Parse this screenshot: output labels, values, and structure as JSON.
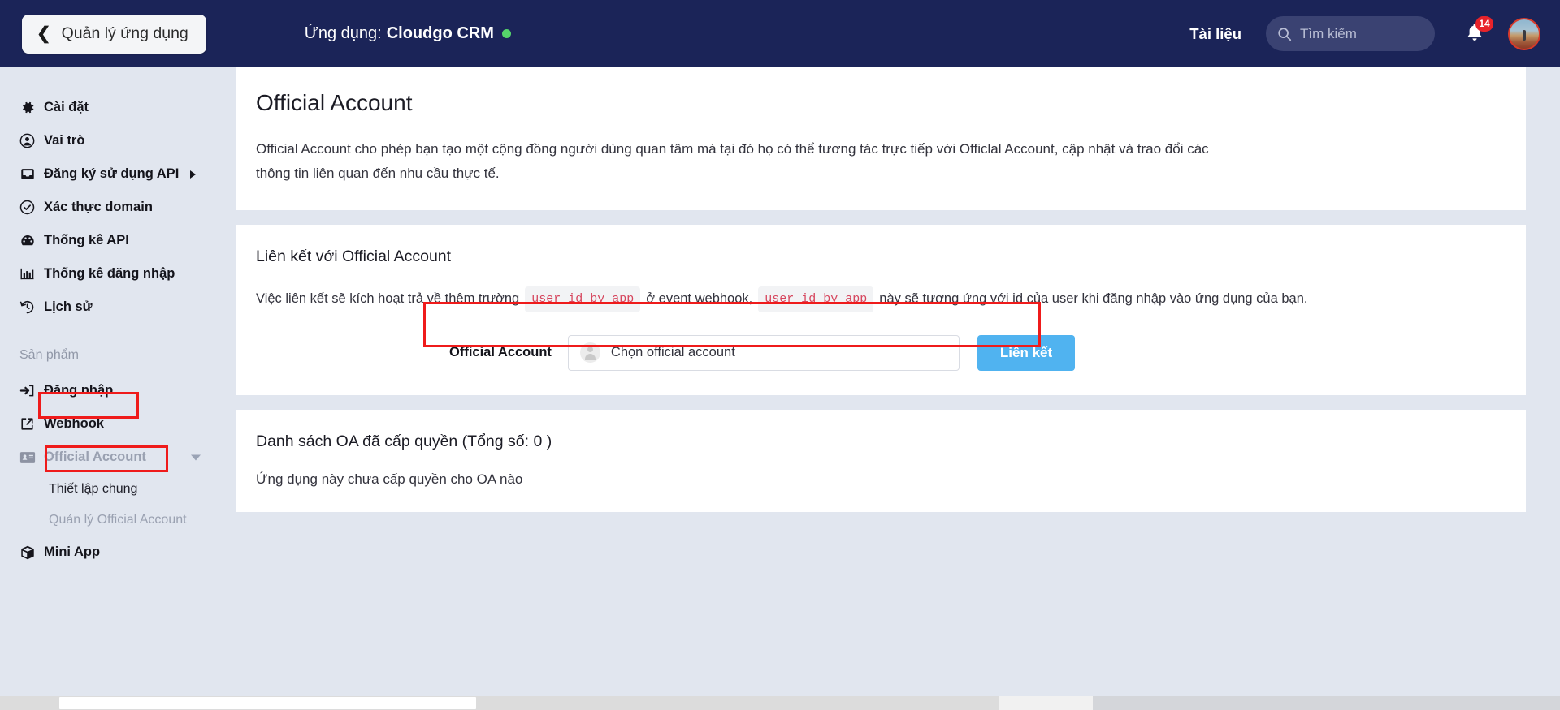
{
  "header": {
    "back_chevron": "chevron-left-icon",
    "back_label": "Quản lý ứng dụng",
    "app_prefix": "Ứng dụng:",
    "app_name": "Cloudgo CRM",
    "docs_label": "Tài liệu",
    "search_placeholder": "Tìm kiếm",
    "search_value": "",
    "notification_count": "14",
    "status_color": "#55d46a",
    "bg_color": "#1b2458"
  },
  "sidebar": {
    "items": [
      {
        "icon": "gear-icon",
        "label": "Cài đặt"
      },
      {
        "icon": "user-circle-icon",
        "label": "Vai trò"
      },
      {
        "icon": "inbox-icon",
        "label": "Đăng ký sử dụng API",
        "caret": "right"
      },
      {
        "icon": "check-circle-icon",
        "label": "Xác thực domain"
      },
      {
        "icon": "speedometer-icon",
        "label": "Thống kê API"
      },
      {
        "icon": "bar-chart-icon",
        "label": "Thống kê đăng nhập"
      },
      {
        "icon": "history-icon",
        "label": "Lịch sử"
      }
    ],
    "section_label": "Sản phẩm",
    "product_items": [
      {
        "icon": "login-icon",
        "label": "Đăng nhập"
      },
      {
        "icon": "external-link-icon",
        "label": "Webhook"
      },
      {
        "icon": "id-card-icon",
        "label": "Official Account",
        "caret": "down",
        "muted": true,
        "highlighted": true
      },
      {
        "icon": "",
        "label": "Thiết lập chung",
        "sub": true
      },
      {
        "icon": "",
        "label": "Quản lý Official Account",
        "sub": true,
        "muted": true,
        "highlighted": true
      },
      {
        "icon": "cube-icon",
        "label": "Mini App"
      }
    ]
  },
  "main": {
    "intro_card": {
      "title": "Official Account",
      "description": "Official Account cho phép bạn tạo một cộng đồng người dùng quan tâm mà tại đó họ có thể tương tác trực tiếp với Officlal Account, cập nhật và trao đổi các thông tin liên quan đến nhu cầu thực tế."
    },
    "link_card": {
      "title": "Liên kết với Official Account",
      "sentence_part1": "Việc liên kết sẽ kích hoạt trả về thêm trường",
      "code_token_1": "user_id_by_app",
      "sentence_part2": "ở event webhook,",
      "code_token_2": "user_id_by_app",
      "sentence_part3": "này sẽ tương ứng với id của user khi đăng nhập vào ứng dụng của bạn.",
      "form_label": "Official Account",
      "select_placeholder": "Chọn official account",
      "select_value": "",
      "button_label": "Liên kết",
      "button_color": "#50b3f0"
    },
    "list_card": {
      "title": "Danh sách OA đã cấp quyền (Tổng số: 0 )",
      "total": "0",
      "empty_message": "Ứng dụng này chưa cấp quyền cho OA nào"
    }
  },
  "highlight_color": "#ef1b1b"
}
